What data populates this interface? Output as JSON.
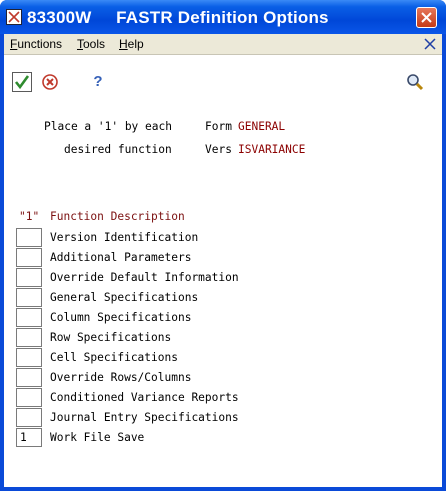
{
  "window": {
    "title": "83300W     FASTR Definition Options"
  },
  "menu": {
    "items": [
      "Functions",
      "Tools",
      "Help"
    ]
  },
  "toolbar": {
    "help_glyph": "?"
  },
  "header": {
    "line1": "Place a '1' by each",
    "line2": "desired function",
    "form_label": "Form",
    "form_value": "GENERAL",
    "vers_label": "Vers",
    "vers_value": "ISVARIANCE"
  },
  "list": {
    "header_col1": "\"1\"",
    "header_col2": "Function Description",
    "rows": [
      {
        "value": "",
        "label": "Version Identification"
      },
      {
        "value": "",
        "label": "Additional Parameters"
      },
      {
        "value": "",
        "label": "Override Default Information"
      },
      {
        "value": "",
        "label": "General Specifications"
      },
      {
        "value": "",
        "label": "Column Specifications"
      },
      {
        "value": "",
        "label": "Row Specifications"
      },
      {
        "value": "",
        "label": "Cell Specifications"
      },
      {
        "value": "",
        "label": "Override Rows/Columns"
      },
      {
        "value": "",
        "label": "Conditioned Variance Reports"
      },
      {
        "value": "",
        "label": "Journal Entry Specifications"
      },
      {
        "value": "1",
        "label": "Work File Save"
      }
    ]
  },
  "colors": {
    "titlebar": "#0047d8",
    "accent_red": "#8b0000",
    "menubar": "#ece9d8"
  }
}
